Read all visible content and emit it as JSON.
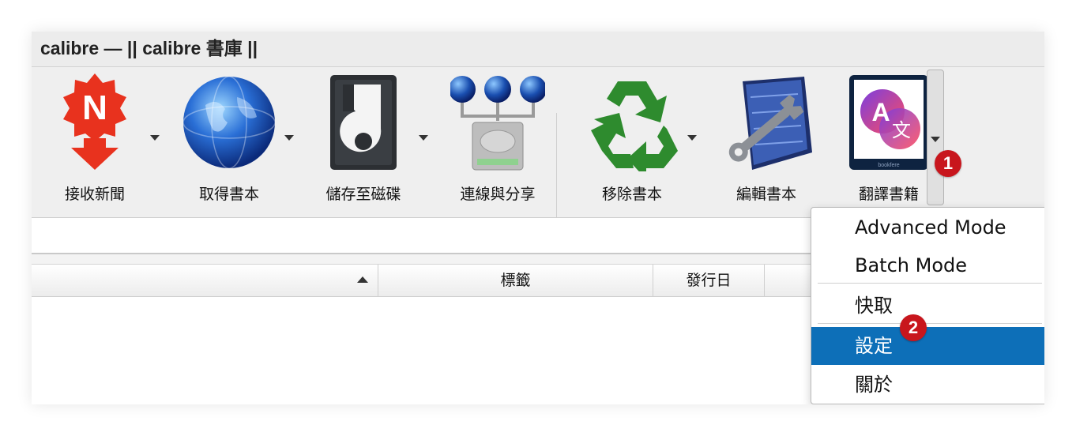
{
  "window": {
    "title": "calibre — || calibre 書庫 ||"
  },
  "toolbar": {
    "items": [
      {
        "label": "接收新聞",
        "icon": "news-download-icon",
        "has_dropdown": true
      },
      {
        "label": "取得書本",
        "icon": "globe-icon",
        "has_dropdown": true
      },
      {
        "label": "儲存至磁碟",
        "icon": "save-disk-icon",
        "has_dropdown": true
      },
      {
        "label": "連線與分享",
        "icon": "network-share-icon",
        "has_dropdown": false
      },
      {
        "label": "移除書本",
        "icon": "recycle-icon",
        "has_dropdown": true
      },
      {
        "label": "編輯書本",
        "icon": "edit-book-icon",
        "has_dropdown": false
      },
      {
        "label": "翻譯書籍",
        "icon": "translate-book-icon",
        "has_dropdown": false
      }
    ],
    "translate_icon_caption": "bookfere",
    "more_button_icon": "chevron-down-icon"
  },
  "table": {
    "columns": [
      {
        "label": "",
        "sorted": "ascending"
      },
      {
        "label": "標籤"
      },
      {
        "label": "發行日"
      }
    ]
  },
  "menu": {
    "items": [
      {
        "label": "Advanced Mode"
      },
      {
        "label": "Batch Mode"
      },
      {
        "label": "快取"
      },
      {
        "label": "設定",
        "active": true
      },
      {
        "label": "關於"
      }
    ]
  },
  "badges": [
    "1",
    "2"
  ],
  "colors": {
    "selection": "#0d6fb8",
    "badge": "#c8161d",
    "recycle_green": "#2e8b2e",
    "news_red": "#e8321e"
  }
}
